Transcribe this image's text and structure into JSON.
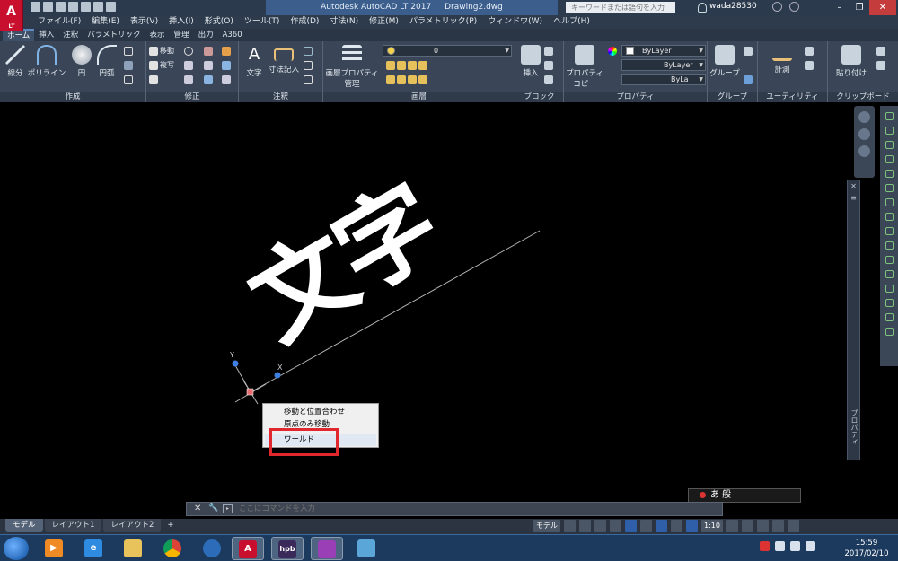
{
  "app": {
    "logo_text": "A",
    "logo_sub": "LT",
    "product": "Autodesk AutoCAD LT 2017",
    "file": "Drawing2.dwg",
    "search_placeholder": "キーワードまたは語句を入力",
    "user": "wada28530"
  },
  "menu": [
    "ファイル(F)",
    "編集(E)",
    "表示(V)",
    "挿入(I)",
    "形式(O)",
    "ツール(T)",
    "作成(D)",
    "寸法(N)",
    "修正(M)",
    "パラメトリック(P)",
    "ウィンドウ(W)",
    "ヘルプ(H)"
  ],
  "tabs": [
    "ホーム",
    "挿入",
    "注釈",
    "パラメトリック",
    "表示",
    "管理",
    "出力",
    "A360"
  ],
  "ribbon": {
    "draw": {
      "title": "作成",
      "line": "線分",
      "polyline": "ポリライン",
      "circle": "円",
      "arc": "円弧"
    },
    "modify": {
      "title": "修正",
      "move": "移動",
      "copy": "複写"
    },
    "annotation": {
      "title": "注釈",
      "text": "文字",
      "dimension": "寸法記入"
    },
    "layers": {
      "title": "画層",
      "layer_props": "画層プロパティ",
      "layer_props2": "管理",
      "current_layer": "0"
    },
    "block": {
      "title": "ブロック",
      "insert": "挿入"
    },
    "properties": {
      "title": "プロパティ",
      "match": "プロパティ",
      "match2": "コピー",
      "color": "ByLayer",
      "linetype": "ByLayer",
      "lineweight": "ByLa"
    },
    "groups": {
      "title": "グループ",
      "group": "グループ"
    },
    "utilities": {
      "title": "ユーティリティ",
      "measure": "計測"
    },
    "clipboard": {
      "title": "クリップボード",
      "paste": "貼り付け"
    }
  },
  "canvas": {
    "text_object": "文字"
  },
  "context_menu": {
    "items": [
      "移動と位置合わせ",
      "原点のみ移動",
      "ワールド"
    ],
    "selected_index": 2
  },
  "properties_palette": {
    "title": "プロパティ"
  },
  "ime": {
    "text": "あ 般"
  },
  "command": {
    "placeholder": "ここにコマンドを入力"
  },
  "layout_tabs": [
    "モデル",
    "レイアウト1",
    "レイアウト2",
    "+"
  ],
  "status": {
    "model": "モデル",
    "scale": "1:10"
  },
  "taskbar": {
    "time": "15:59",
    "date": "2017/02/10"
  },
  "colors": {
    "selection_box": "#e0282e",
    "accent": "#3b5e8c",
    "canvas": "#000000"
  }
}
